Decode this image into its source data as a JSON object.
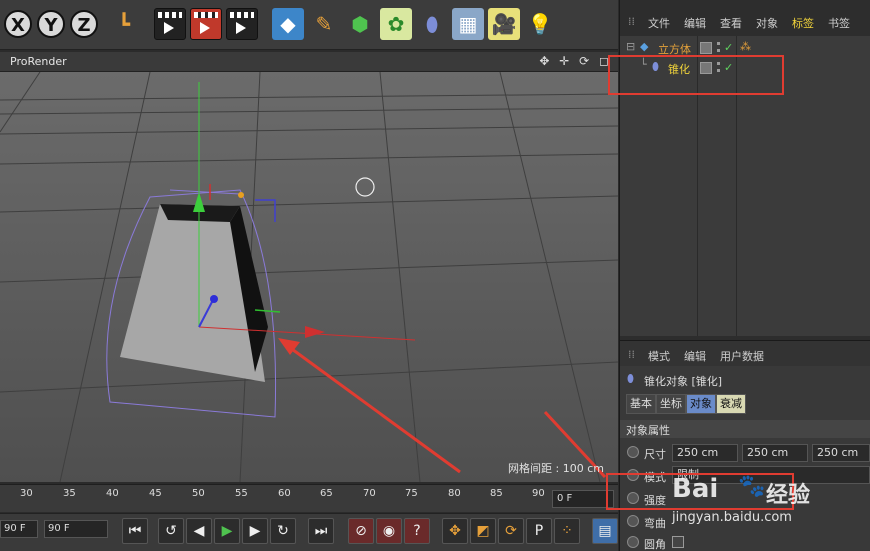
{
  "toolbar": {
    "axis_x": "X",
    "axis_y": "Y",
    "axis_z": "Z",
    "icons": [
      "coordinate-system-icon",
      "render-view-icon",
      "render-picture-viewer-icon",
      "render-settings-icon",
      "cube-icon",
      "pen-icon",
      "subdivision-icon",
      "mograph-cloner-icon",
      "deformer-icon",
      "floor-icon",
      "camera-icon",
      "light-icon"
    ]
  },
  "viewport": {
    "title": "ProRender",
    "grid_spacing": "网格间距 : 100 cm",
    "nav_icons": "✥ ✛ ⟳ ◻"
  },
  "timeline": {
    "ticks": [
      "30",
      "35",
      "40",
      "45",
      "50",
      "55",
      "60",
      "65",
      "70",
      "75",
      "80",
      "85",
      "90"
    ],
    "current_frame": "0 F",
    "start_frame": "90 F",
    "end_frame": "90 F"
  },
  "object_manager": {
    "menu": [
      "文件",
      "编辑",
      "查看",
      "对象",
      "标签",
      "书签"
    ],
    "objects": [
      {
        "name": "立方体",
        "color": "#e3a13b"
      },
      {
        "name": "锥化",
        "color": "#f0d33a"
      }
    ]
  },
  "attribute_manager": {
    "menu": [
      "模式",
      "编辑",
      "用户数据"
    ],
    "object_title": "锥化对象 [锥化]",
    "tabs": [
      "基本",
      "坐标",
      "对象",
      "衰减"
    ],
    "active_tab": "对象",
    "section": "对象属性",
    "size_label": "尺寸",
    "size_values": [
      "250 cm",
      "250 cm",
      "250 cm"
    ],
    "mode_label": "模式",
    "mode_value": "限制",
    "strength_label": "强度",
    "curve_label": "弯曲",
    "fillet_label": "圆角"
  },
  "watermark": {
    "brand": "Bai",
    "brand_suffix": "经验",
    "url": "jingyan.baidu.com"
  }
}
